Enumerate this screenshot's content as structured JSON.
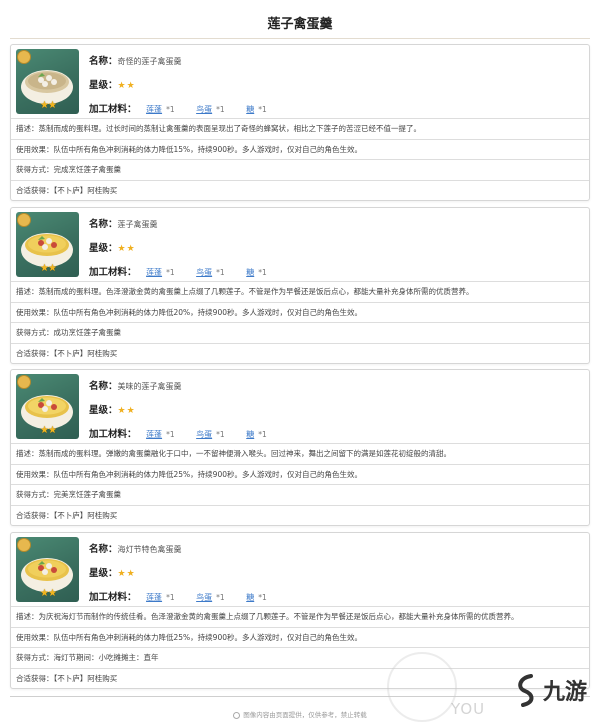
{
  "page_title": "莲子禽蛋羹",
  "labels": {
    "name": "名称：",
    "rarity": "星级：",
    "materials": "加工材料："
  },
  "colors": {
    "link": "#3d7ac9",
    "star": "#f0b020",
    "thumb_bg": "#3f7b67"
  },
  "icons": {
    "rarity_star": "star-icon",
    "thumb_badge": "character-badge-icon"
  },
  "recipes": [
    {
      "name": "奇怪的莲子禽蛋羹",
      "stars": "★★",
      "thumb_stars": "★★",
      "materials": [
        {
          "name": "莲蓬",
          "qty": "*1"
        },
        {
          "name": "鸟蛋",
          "qty": "*1"
        },
        {
          "name": "糖",
          "qty": "*1"
        }
      ],
      "description": "描述：蒸制而成的蛋料理。过长时间的蒸制让禽蛋羹的表面呈现出了奇怪的蜂窝状，相比之下莲子的苦涩已经不值一提了。",
      "effect": "使用效果：队伍中所有角色冲刺消耗的体力降低15%，持续900秒。多人游戏时，仅对自己的角色生效。",
      "obtain": "获得方式：完成烹饪莲子禽蛋羹",
      "vendor": "合适获得：【不卜庐】阿桂购买"
    },
    {
      "name": "莲子禽蛋羹",
      "stars": "★★",
      "thumb_stars": "★★",
      "materials": [
        {
          "name": "莲蓬",
          "qty": "*1"
        },
        {
          "name": "鸟蛋",
          "qty": "*1"
        },
        {
          "name": "糖",
          "qty": "*1"
        }
      ],
      "description": "描述：蒸制而成的蛋料理。色泽澄澈金黄的禽蛋羹上点缀了几颗莲子。不管是作为早餐还是饭后点心，都能大量补充身体所需的优质营养。",
      "effect": "使用效果：队伍中所有角色冲刺消耗的体力降低20%，持续900秒。多人游戏时，仅对自己的角色生效。",
      "obtain": "获得方式：成功烹饪莲子禽蛋羹",
      "vendor": "合适获得：【不卜庐】阿桂购买"
    },
    {
      "name": "美味的莲子禽蛋羹",
      "stars": "★★",
      "thumb_stars": "★★",
      "materials": [
        {
          "name": "莲蓬",
          "qty": "*1"
        },
        {
          "name": "鸟蛋",
          "qty": "*1"
        },
        {
          "name": "糖",
          "qty": "*1"
        }
      ],
      "description": "描述：蒸制而成的蛋料理。弹嫩的禽蛋羹融化于口中，一不留神便滑入喉头。回过神来，舞出之间留下的满是如莲花初绽般的清甜。",
      "effect": "使用效果：队伍中所有角色冲刺消耗的体力降低25%，持续900秒。多人游戏时，仅对自己的角色生效。",
      "obtain": "获得方式：完美烹饪莲子禽蛋羹",
      "vendor": "合适获得：【不卜庐】阿桂购买"
    },
    {
      "name": "海灯节特色禽蛋羹",
      "stars": "★★",
      "thumb_stars": "★★",
      "materials": [
        {
          "name": "莲蓬",
          "qty": "*1"
        },
        {
          "name": "鸟蛋",
          "qty": "*1"
        },
        {
          "name": "糖",
          "qty": "*1"
        }
      ],
      "description": "描述：为庆祝海灯节而制作的传统佳肴。色泽澄澈金黄的禽蛋羹上点缀了几颗莲子。不管是作为早餐还是饭后点心，都能大量补充身体所需的优质营养。",
      "effect": "使用效果：队伍中所有角色冲刺消耗的体力降低25%，持续900秒。多人游戏时，仅对自己的角色生效。",
      "obtain": "获得方式：海灯节期间：小吃摊摊主：直年",
      "vendor": "合适获得：【不卜庐】阿桂购买"
    }
  ],
  "footer_text": "图像内容由页面提供，仅供参考，禁止转载",
  "watermark": "YOU",
  "logo_text": "九游"
}
